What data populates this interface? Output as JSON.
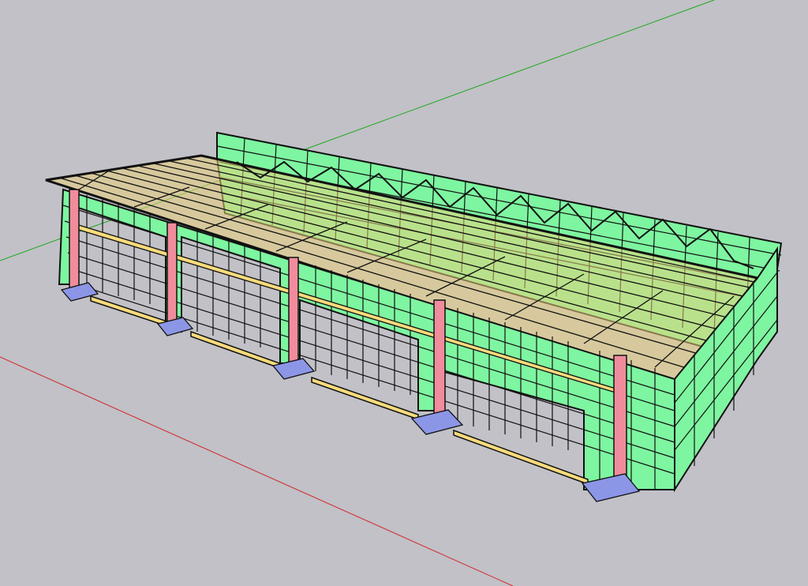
{
  "viewport": {
    "kind": "3d-model-viewport",
    "background": "#c1c1c7",
    "axes": [
      {
        "name": "red-axis",
        "color": "#d22828"
      },
      {
        "name": "green-axis",
        "color": "#21a821"
      }
    ]
  },
  "model": {
    "description_kind": "structural-frame-building",
    "bay_count": 5,
    "column_count": 6,
    "colors": {
      "wall_panel": "#7ef5a0",
      "grid_line": "#111111",
      "column": "#f08c9c",
      "beam": "#f7db7c",
      "footing": "#8c96e6",
      "roof_purlin": "#e9cf7a"
    }
  }
}
